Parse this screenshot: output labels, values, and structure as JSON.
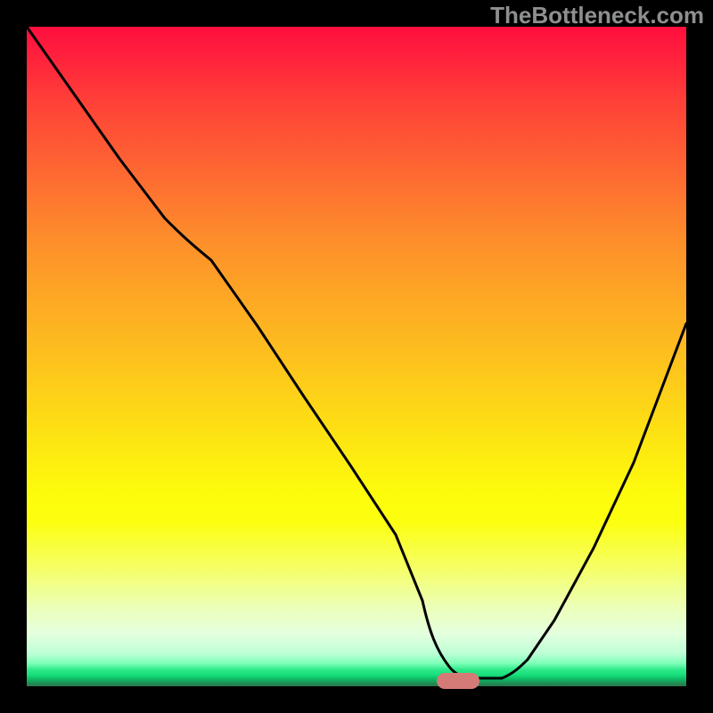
{
  "watermark": "TheBottleneck.com",
  "colors": {
    "frame": "#000000",
    "gradient_top": "#FF0E3E",
    "gradient_mid": "#FDE313",
    "gradient_bottom_green": "#2EE98A",
    "curve_stroke": "#000000",
    "marker_fill": "#D47B78",
    "watermark_text": "#8E8F8F"
  },
  "chart_data": {
    "type": "line",
    "title": "",
    "xlabel": "",
    "ylabel": "",
    "xlim": [
      0,
      100
    ],
    "ylim": [
      0,
      100
    ],
    "grid": false,
    "legend": false,
    "series": [
      {
        "name": "bottleneck-curve",
        "x": [
          0,
          7,
          14,
          21,
          28,
          35,
          42,
          49,
          56,
          60,
          63,
          66,
          68,
          72,
          76,
          80,
          86,
          92,
          100
        ],
        "values": [
          100,
          90,
          80,
          71,
          72,
          60,
          49,
          37,
          23,
          13,
          7,
          3,
          1,
          1,
          4,
          10,
          21,
          34,
          55
        ],
        "note": "y is pseudo 'bottleneck %' — left branch descends from top to valley ~x=66, right branch rises; shown over a vertical red→yellow→green performance gradient."
      }
    ],
    "marker": {
      "name": "optimal-range-pill",
      "x_center": 67,
      "y": 1,
      "color": "#D47B78"
    },
    "background_gradient": {
      "orientation": "vertical",
      "stops": [
        {
          "pos": 0.0,
          "color": "#FF0E3E"
        },
        {
          "pos": 0.32,
          "color": "#FD8D2B"
        },
        {
          "pos": 0.62,
          "color": "#FDE313"
        },
        {
          "pos": 0.88,
          "color": "#ECFFB8"
        },
        {
          "pos": 0.97,
          "color": "#2EE98A"
        },
        {
          "pos": 1.0,
          "color": "#2E7A4F"
        }
      ]
    }
  }
}
